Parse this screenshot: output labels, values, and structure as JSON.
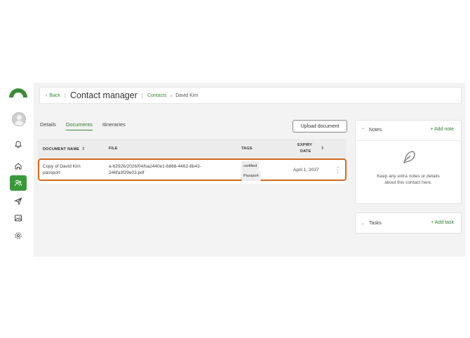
{
  "header": {
    "back_label": "Back",
    "title": "Contact manager",
    "breadcrumb_contacts": "Contacts",
    "breadcrumb_name": "David Kim"
  },
  "tabs": [
    {
      "label": "Details",
      "active": false
    },
    {
      "label": "Documents",
      "active": true
    },
    {
      "label": "Itineraries",
      "active": false
    }
  ],
  "upload_label": "Upload document",
  "table": {
    "columns": [
      "DOCUMENT NAME",
      "FILE",
      "TAGS",
      "EXPIRY",
      "DATE"
    ],
    "rows": [
      {
        "name_line1": "Copy of David Kim",
        "name_line2": "passport",
        "file_line1": "a-62926/2026/04/ba2440e1-6868-4462-8b43-",
        "file_line2": "246fa3f29e03.pdf",
        "tags": [
          "certified",
          "Passport"
        ],
        "expiry": "April 1, 2037"
      }
    ]
  },
  "notes": {
    "title": "Notes",
    "add_label": "+ Add note",
    "empty_line1": "Keep any extra notes or details",
    "empty_line2": "about this contact here."
  },
  "tasks": {
    "title": "Tasks",
    "add_label": "+ Add task"
  },
  "colors": {
    "accent": "#3a8a3a",
    "highlight_border": "#d2691e"
  }
}
